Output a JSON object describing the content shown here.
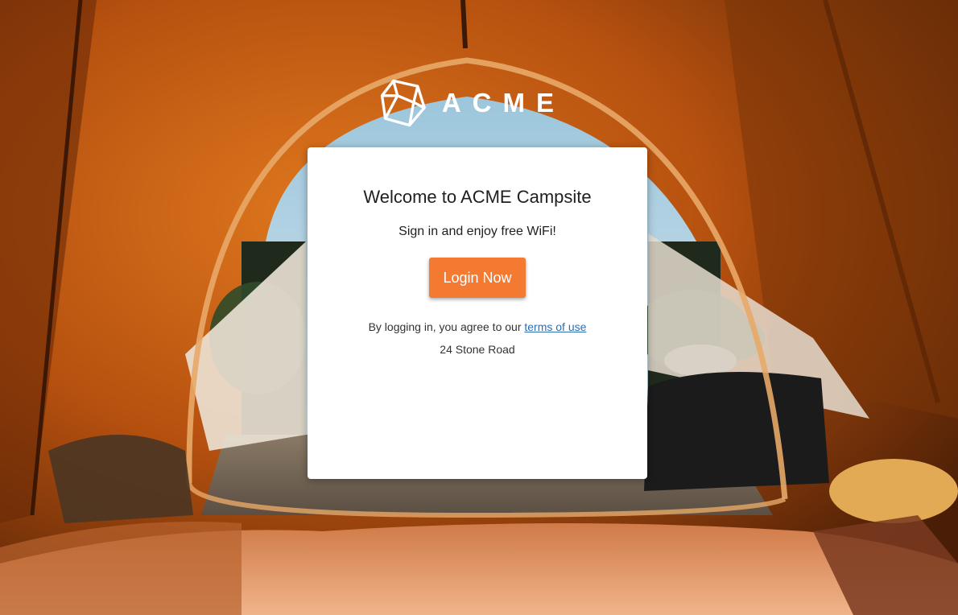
{
  "brand": {
    "name": "ACME",
    "logo_icon": "cube-outline-icon"
  },
  "card": {
    "title": "Welcome to ACME Campsite",
    "subtitle": "Sign in and enjoy free WiFi!",
    "login_button": "Login Now",
    "terms_prefix": "By logging in, you agree to our ",
    "terms_link": "terms of use",
    "address": "24 Stone Road"
  },
  "colors": {
    "accent": "#f47a32",
    "link": "#2a6db5",
    "card_bg": "#ffffff"
  }
}
